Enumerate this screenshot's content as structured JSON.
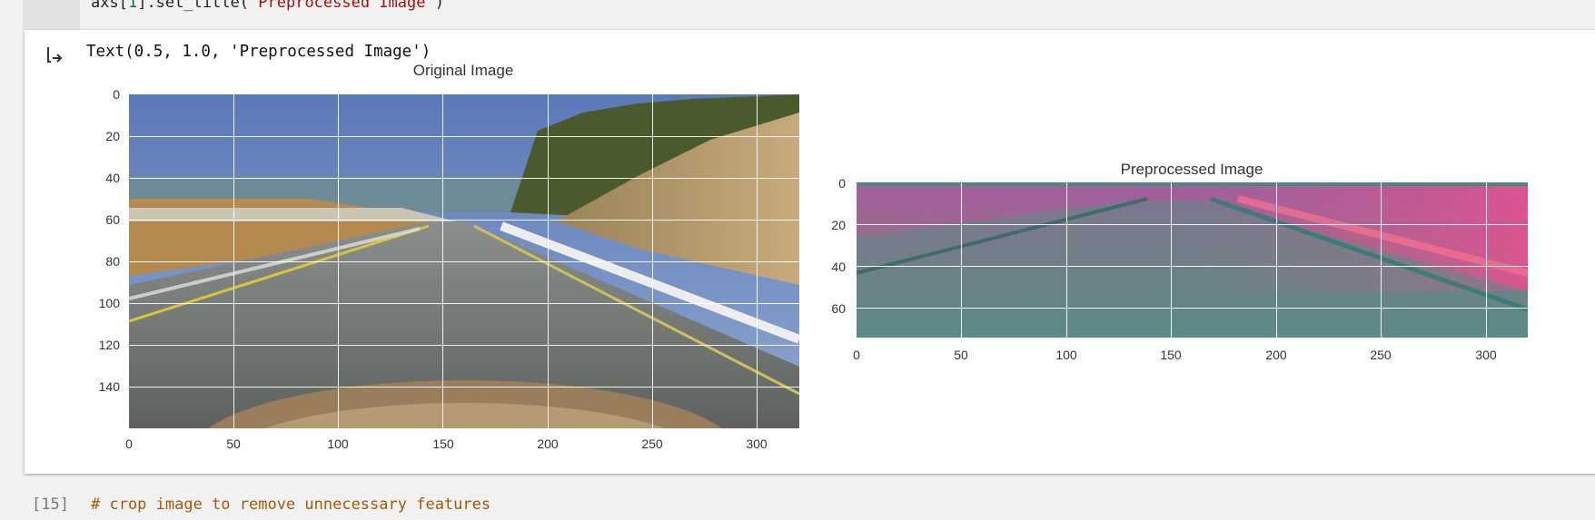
{
  "top_cell": {
    "code_prefix": "axs[",
    "code_index": "1",
    "code_mid": "].set_title(",
    "code_string": "'Preprocessed Image'",
    "code_suffix": ")"
  },
  "output": {
    "text_repr": "Text(0.5, 1.0, 'Preprocessed Image')",
    "icon": "output-arrow-icon"
  },
  "plots": [
    {
      "title": "Original Image",
      "x_ticks": [
        "0",
        "50",
        "100",
        "150",
        "200",
        "250",
        "300"
      ],
      "y_ticks": [
        "0",
        "20",
        "40",
        "60",
        "80",
        "100",
        "120",
        "140"
      ]
    },
    {
      "title": "Preprocessed Image",
      "x_ticks": [
        "0",
        "50",
        "100",
        "150",
        "200",
        "250",
        "300"
      ],
      "y_ticks": [
        "0",
        "20",
        "40",
        "60"
      ]
    }
  ],
  "bottom_cell": {
    "number": "[15]",
    "comment": "# crop image to remove unnecessary features"
  },
  "colors": {
    "comment": "#a25b06",
    "string": "#a11111",
    "page_bg": "#f1f1f1",
    "output_bg": "#ffffff"
  }
}
